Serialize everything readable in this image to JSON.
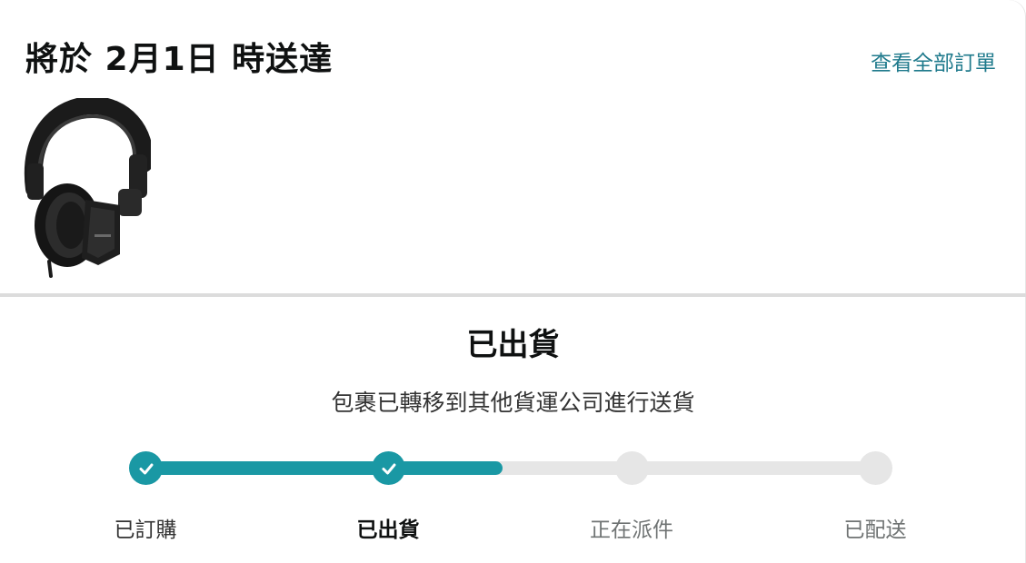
{
  "header": {
    "title": "將於 2月1日 時送達",
    "view_all_orders": "查看全部訂單"
  },
  "product": {
    "image_icon": "headphones-image"
  },
  "shipment": {
    "status": "已出貨",
    "detail": "包裹已轉移到其他貨運公司進行送貨"
  },
  "progress": {
    "steps": [
      {
        "label": "已訂購",
        "state": "done"
      },
      {
        "label": "已出貨",
        "state": "current"
      },
      {
        "label": "正在派件",
        "state": "pending"
      },
      {
        "label": "已配送",
        "state": "pending"
      }
    ],
    "fill_fraction": 0.49,
    "colors": {
      "accent": "#1a98a4",
      "track": "#e6e6e6",
      "link": "#1f7a8c"
    }
  }
}
